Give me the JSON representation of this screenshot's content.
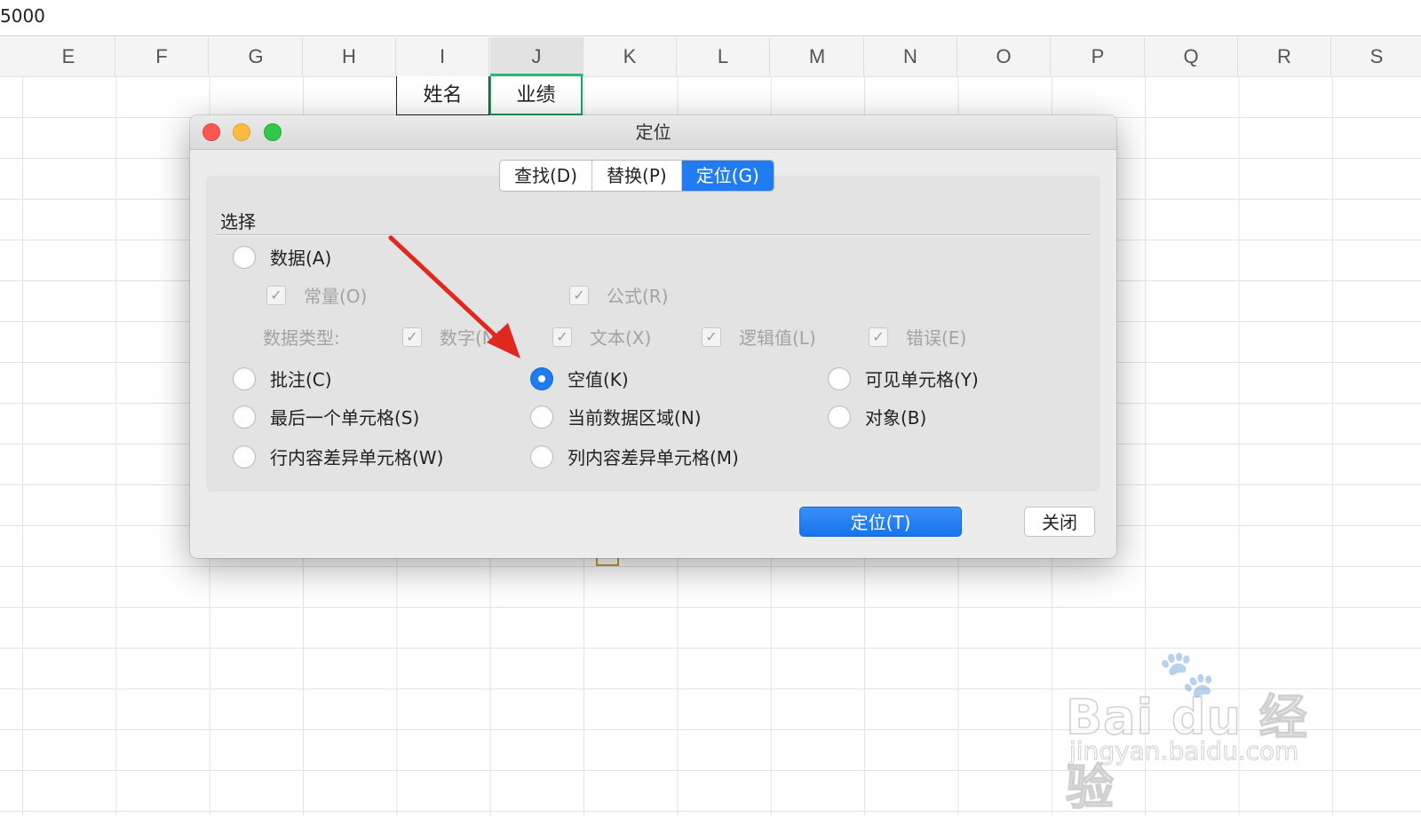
{
  "formula_bar": {
    "value": "5000"
  },
  "columns": [
    "E",
    "F",
    "G",
    "H",
    "I",
    "J",
    "K",
    "L",
    "M",
    "N",
    "O",
    "P",
    "Q",
    "R",
    "S"
  ],
  "active_column": "J",
  "header_cells": {
    "name": "姓名",
    "score": "业绩"
  },
  "dialog": {
    "title": "定位",
    "tabs": [
      {
        "label": "查找(D)",
        "active": false
      },
      {
        "label": "替换(P)",
        "active": false
      },
      {
        "label": "定位(G)",
        "active": true
      }
    ],
    "section_label": "选择",
    "options": {
      "data": {
        "label": "数据(A)",
        "selected": false
      },
      "constants": {
        "label": "常量(O)",
        "checked": true,
        "enabled": false
      },
      "formulas": {
        "label": "公式(R)",
        "checked": true,
        "enabled": false
      },
      "data_type_label": "数据类型:",
      "number": {
        "label": "数字(N)",
        "checked": true,
        "enabled": false
      },
      "text": {
        "label": "文本(X)",
        "checked": true,
        "enabled": false
      },
      "logical": {
        "label": "逻辑值(L)",
        "checked": true,
        "enabled": false
      },
      "error": {
        "label": "错误(E)",
        "checked": true,
        "enabled": false
      },
      "comments": {
        "label": "批注(C)",
        "selected": false
      },
      "blanks": {
        "label": "空值(K)",
        "selected": true
      },
      "visible_cells": {
        "label": "可见单元格(Y)",
        "selected": false
      },
      "last_cell": {
        "label": "最后一个单元格(S)",
        "selected": false
      },
      "current_region": {
        "label": "当前数据区域(N)",
        "selected": false
      },
      "objects": {
        "label": "对象(B)",
        "selected": false
      },
      "row_differences": {
        "label": "行内容差异单元格(W)",
        "selected": false
      },
      "column_differences": {
        "label": "列内容差异单元格(M)",
        "selected": false
      }
    },
    "buttons": {
      "go_to": "定位(T)",
      "close": "关闭"
    }
  },
  "watermark": {
    "main": "Bai du 经验",
    "sub": "jingyan.baidu.com"
  },
  "colors": {
    "accent": "#1f7cf3",
    "arrow": "#e0281f",
    "active_col": "#2bb673"
  }
}
